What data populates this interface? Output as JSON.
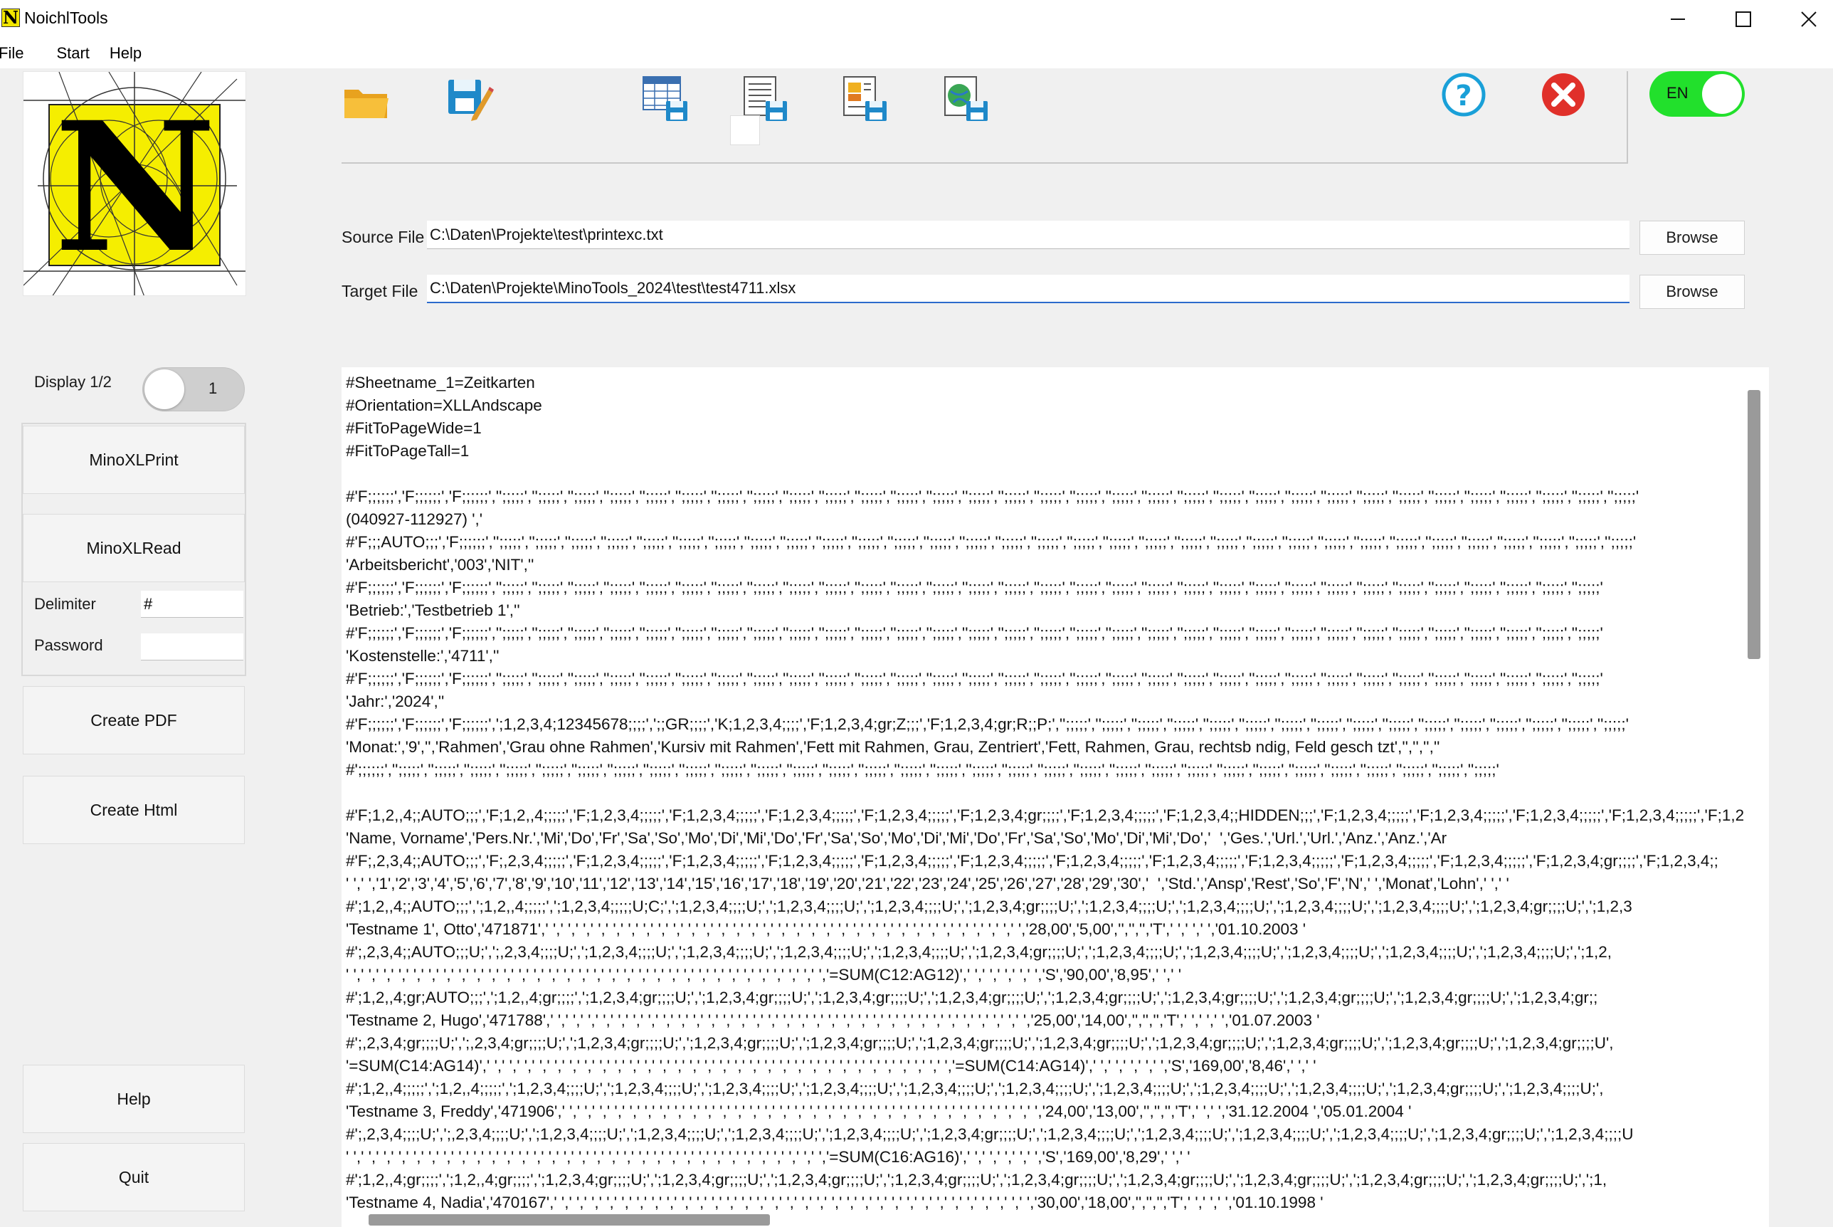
{
  "window": {
    "title": "NoichlTools",
    "logo_letter": "N"
  },
  "menu": [
    {
      "label": "File"
    },
    {
      "label": "Start"
    },
    {
      "label": "Help"
    }
  ],
  "toolbar": {
    "icons": [
      "folder-open-icon",
      "save-edit-icon",
      "save-table-icon",
      "save-document-icon",
      "save-chart-icon",
      "save-web-icon",
      "help-icon",
      "close-icon"
    ],
    "lang_toggle": "EN",
    "colors": {
      "lang_on": "#22e02c",
      "help": "#1aa0d8",
      "close": "#e0302a"
    }
  },
  "sidebar": {
    "display_label": "Display 1/2",
    "display_value": "1",
    "buttons": {
      "print": "MinoXLPrint",
      "read": "MinoXLRead",
      "pdf": "Create PDF",
      "html": "Create Html",
      "help": "Help",
      "quit": "Quit"
    },
    "delimiter_label": "Delimiter",
    "delimiter_value": "#",
    "password_label": "Password",
    "password_value": ""
  },
  "files": {
    "source_label": "Source File",
    "source_value": "C:\\Daten\\Projekte\\test\\printexc.txt",
    "target_label": "Target File",
    "target_value": "C:\\Daten\\Projekte\\MinoTools_2024\\test\\test4711.xlsx",
    "browse": "Browse"
  },
  "content_lines": [
    "#Sheetname_1=Zeitkarten",
    "#Orientation=XLLAndscape",
    "#FitToPageWide=1",
    "#FitToPageTall=1",
    "",
    "#'F;;;;;;','F;;;;;;','F;;;;;;','';;;;;','';;;;;','';;;;;','';;;;;','';;;;;','';;;;;','';;;;;','';;;;;','';;;;;','';;;;;','';;;;;','';;;;;','';;;;;','';;;;;','';;;;;','';;;;;','';;;;;','';;;;;','';;;;;','';;;;;','';;;;;','';;;;;','';;;;;','';;;;;','';;;;;','';;;;;','';;;;;','';;;;;','';;;;;','';;;;;','';;;;;','';;;;;'",
    "(040927-112927) ','",
    "#'F;;;AUTO;;;','F;;;;;;','';;;;;','';;;;;','';;;;;','';;;;;','';;;;;','';;;;;','';;;;;','';;;;;','';;;;;','';;;;;','';;;;;','';;;;;','';;;;;','';;;;;','';;;;;','';;;;;','';;;;;','';;;;;','';;;;;','';;;;;','';;;;;','';;;;;','';;;;;','';;;;;','';;;;;','';;;;;','';;;;;','';;;;;','';;;;;','';;;;;','';;;;;','';;;;;'",
    "'Arbeitsbericht','003','NIT',''",
    "#'F;;;;;;','F;;;;;;','F;;;;;;','';;;;;','';;;;;','';;;;;','';;;;;','';;;;;','';;;;;','';;;;;','';;;;;','';;;;;','';;;;;','';;;;;','';;;;;','';;;;;','';;;;;','';;;;;','';;;;;','';;;;;','';;;;;','';;;;;','';;;;;','';;;;;','';;;;;','';;;;;','';;;;;','';;;;;','';;;;;','';;;;;','';;;;;','';;;;;','';;;;;','';;;;;'",
    "'Betrieb:','Testbetrieb 1',''",
    "#'F;;;;;;','F;;;;;;','F;;;;;;','';;;;;','';;;;;','';;;;;','';;;;;','';;;;;','';;;;;','';;;;;','';;;;;','';;;;;','';;;;;','';;;;;','';;;;;','';;;;;','';;;;;','';;;;;','';;;;;','';;;;;','';;;;;','';;;;;','';;;;;','';;;;;','';;;;;','';;;;;','';;;;;','';;;;;','';;;;;','';;;;;','';;;;;','';;;;;','';;;;;','';;;;;'",
    "'Kostenstelle:','4711',''",
    "#'F;;;;;;','F;;;;;;','F;;;;;;','';;;;;','';;;;;','';;;;;','';;;;;','';;;;;','';;;;;','';;;;;','';;;;;','';;;;;','';;;;;','';;;;;','';;;;;','';;;;;','';;;;;','';;;;;','';;;;;','';;;;;','';;;;;','';;;;;','';;;;;','';;;;;','';;;;;','';;;;;','';;;;;','';;;;;','';;;;;','';;;;;','';;;;;','';;;;;','';;;;;','';;;;;'",
    "'Jahr:','2024',''",
    "#'F;;;;;;','F;;;;;;','F;;;;;;',';1,2,3,4;12345678;;;;',';;GR;;;;','K;1,2,3,4;;;;','F;1,2,3,4;gr;Z;;;','F;1,2,3,4;gr;R;;P;','';;;;;','';;;;;','';;;;;','';;;;;','';;;;;','';;;;;','';;;;;','';;;;;','';;;;;','';;;;;','';;;;;','';;;;;','';;;;;','';;;;;','';;;;;','';;;;;'",
    "'Monat:','9','','Rahmen','Grau ohne Rahmen','Kursiv mit Rahmen','Fett mit Rahmen, Grau, Zentriert','Fett, Rahmen, Grau, rechtsb ndig, Feld gesch tzt','','','',''",
    "#';;;;;;','';;;;;','';;;;;','';;;;;','';;;;;','';;;;;','';;;;;','';;;;;','';;;;;','';;;;;','';;;;;','';;;;;','';;;;;','';;;;;','';;;;;','';;;;;','';;;;;','';;;;;','';;;;;','';;;;;','';;;;;','';;;;;','';;;;;','';;;;;','';;;;;','';;;;;','';;;;;','';;;;;','';;;;;','';;;;;','';;;;;','';;;;;'",
    "",
    "#'F;1,2,,4;;AUTO;;;','F;1,2,,4;;;;;','F;1,2,3,4;;;;;','F;1,2,3,4;;;;;','F;1,2,3,4;;;;;','F;1,2,3,4;;;;;','F;1,2,3,4;gr;;;;','F;1,2,3,4;;;;;','F;1,2,3,4;;HIDDEN;;;','F;1,2,3,4;;;;;','F;1,2,3,4;;;;;','F;1,2,3,4;;;;;','F;1,2,3,4;;;;;','F;1,2,3,4;gr;;;;','F",
    "'Name, Vorname','Pers.Nr.','Mi','Do','Fr','Sa','So','Mo','Di','Mi','Do','Fr','Sa','So','Mo','Di','Mi','Do','Fr','Sa','So','Mo','Di','Mi','Do','  ','Ges.','Url.','Url.','Anz.','Anz.','Ar",
    "#'F;,2,3,4;;AUTO;;;','F;,2,3,4;;;;;','F;1,2,3,4;;;;;','F;1,2,3,4;;;;;','F;1,2,3,4;;;;;','F;1,2,3,4;;;;;','F;1,2,3,4;;;;;','F;1,2,3,4;;;;;','F;1,2,3,4;;;;;','F;1,2,3,4;;;;;','F;1,2,3,4;;;;;','F;1,2,3,4;;;;;','F;1,2,3,4;gr;;;;','F;1,2,3,4;;",
    "' ',' ','1','2','3','4','5','6','7','8','9','10','11','12','13','14','15','16','17','18','19','20','21','22','23','24','25','26','27','28','29','30','  ','Std.','Ansp','Rest','So','F','N',' ','Monat','Lohn',' ',' '",
    "#';1,2,,4;;AUTO;;;',';1,2,,4;;;;;',';1,2,3,4;;;;;U;C;',';1,2,3,4;;;;U;',';1,2,3,4;;;;U;',';1,2,3,4;;;;U;',';1,2,3,4;gr;;;;U;',';1,2,3,4;;;;U;',';1,2,3,4;;;;U;',';1,2,3,4;;;;U;',';1,2,3,4;;;;U;',';1,2,3,4;gr;;;;U;',';1,2,3",
    "'Testname 1', Otto','471871',' ',' ',' ',' ',' ',' ',' ',' ',' ',' ',' ',' ',' ',' ',' ',' ',' ',' ',' ',' ',' ',' ',' ',' ',' ',' ',' ',' ',' ',' ',' ',' ','28,00','5,00','','','','T',' ',' ',' ','01.10.2003 '",
    "#';,2,3,4;;AUTO;;;U;',';,2,3,4;;;;U;',';1,2,3,4;;;;U;',';1,2,3,4;;;;U;',';1,2,3,4;;;;U;',';1,2,3,4;;;;U;',';1,2,3,4;gr;;;;U;',';1,2,3,4;;;;U;',';1,2,3,4;;;;U;',';1,2,3,4;;;;U;',';1,2,3,4;;;;U;',';1,2,3,4;;;;U;',';1,2,",
    "' ',' ',' ',' ',' ',' ',' ',' ',' ',' ',' ',' ',' ',' ',' ',' ',' ',' ',' ',' ',' ',' ',' ',' ',' ',' ',' ',' ',' ',' ',' ',' ','=SUM(C12:AG12)',' ',' ',' ',' ',' ','S','90,00','8,95',' ',' '",
    "#';1,2,,4;gr;AUTO;;;',';1,2,,4;gr;;;;',';1,2,3,4;gr;;;;U;',';1,2,3,4;gr;;;;U;',';1,2,3,4;gr;;;;U;',';1,2,3,4;gr;;;;U;',';1,2,3,4;gr;;;;U;',';1,2,3,4;gr;;;;U;',';1,2,3,4;gr;;;;U;',';1,2,3,4;gr;;;;U;',';1,2,3,4;gr;;",
    "'Testname 2, Hugo','471788',' ',' ',' ',' ',' ',' ',' ',' ',' ',' ',' ',' ',' ',' ',' ',' ',' ',' ',' ',' ',' ',' ',' ',' ',' ',' ',' ',' ',' ',' ',' ',' ','25,00','14,00','','','','T',' ',' ',' ','01.07.2003 '",
    "#';,2,3,4;gr;;;;U;',';,2,3,4;gr;;;;U;',';1,2,3,4;gr;;;;U;',';1,2,3,4;gr;;;;U;',';1,2,3,4;gr;;;;U;',';1,2,3,4;gr;;;;U;',';1,2,3,4;gr;;;;U;',';1,2,3,4;gr;;;;U;',';1,2,3,4;gr;;;;U;',';1,2,3,4;gr;;;;U;',';1,2,3,4;gr;;;;U',",
    "'=SUM(C14:AG14)',' ',' ',' ',' ',' ',' ',' ',' ',' ',' ',' ',' ',' ',' ',' ',' ',' ',' ',' ',' ',' ',' ',' ',' ',' ',' ',' ',' ',' ',' ',' ','=SUM(C14:AG14)',' ',' ',' ',' ',' ','S','169,00','8,46',' ',' '",
    "#';1,2,,4;;;;;',';1,2,,4;;;;;',';1,2,3,4;;;;U;',';1,2,3,4;;;;U;',';1,2,3,4;;;;U;',';1,2,3,4;;;;U;',';1,2,3,4;;;;U;',';1,2,3,4;;;;U;',';1,2,3,4;;;;U;',';1,2,3,4;;;;U;',';1,2,3,4;;;;U;',';1,2,3,4;gr;;;;U;',';1,2,3,4;;;;U;',",
    "'Testname 3, Freddy','471906',' ',' ',' ',' ',' ',' ',' ',' ',' ',' ',' ',' ',' ',' ',' ',' ',' ',' ',' ',' ',' ',' ',' ',' ',' ',' ',' ',' ',' ',' ',' ',' ','24,00','13,00','','','','T',' ',' ','31.12.2004 ','05.01.2004 '",
    "#';,2,3,4;;;;U;',';,2,3,4;;;;U;',';1,2,3,4;;;;U;',';1,2,3,4;;;;U;',';1,2,3,4;;;;U;',';1,2,3,4;;;;U;',';1,2,3,4;gr;;;;U;',';1,2,3,4;;;;U;',';1,2,3,4;;;;U;',';1,2,3,4;;;;U;',';1,2,3,4;;;;U;',';1,2,3,4;gr;;;;U;',';1,2,3,4;;;;U",
    "' ',' ',' ',' ',' ',' ',' ',' ',' ',' ',' ',' ',' ',' ',' ',' ',' ',' ',' ',' ',' ',' ',' ',' ',' ',' ',' ',' ',' ',' ',' ',' ','=SUM(C16:AG16)',' ',' ',' ',' ',' ','S','169,00','8,29',' ',' '",
    "#';1,2,,4;gr;;;;',';1,2,,4;gr;;;;',';1,2,3,4;gr;;;;U;',';1,2,3,4;gr;;;;U;',';1,2,3,4;gr;;;;U;',';1,2,3,4;gr;;;;U;',';1,2,3,4;gr;;;;U;',';1,2,3,4;gr;;;;U;',';1,2,3,4;gr;;;;U;',';1,2,3,4;gr;;;;U;',';1,2,3,4;gr;;;;U;',';1,",
    "'Testname 4, Nadia','470167',' ',' ',' ',' ',' ',' ',' ',' ',' ',' ',' ',' ',' ',' ',' ',' ',' ',' ',' ',' ',' ',' ',' ',' ',' ',' ',' ',' ',' ',' ',' ',' ','30,00','18,00','','','','T',' ',' ',' ','01.10.1998 '"
  ]
}
